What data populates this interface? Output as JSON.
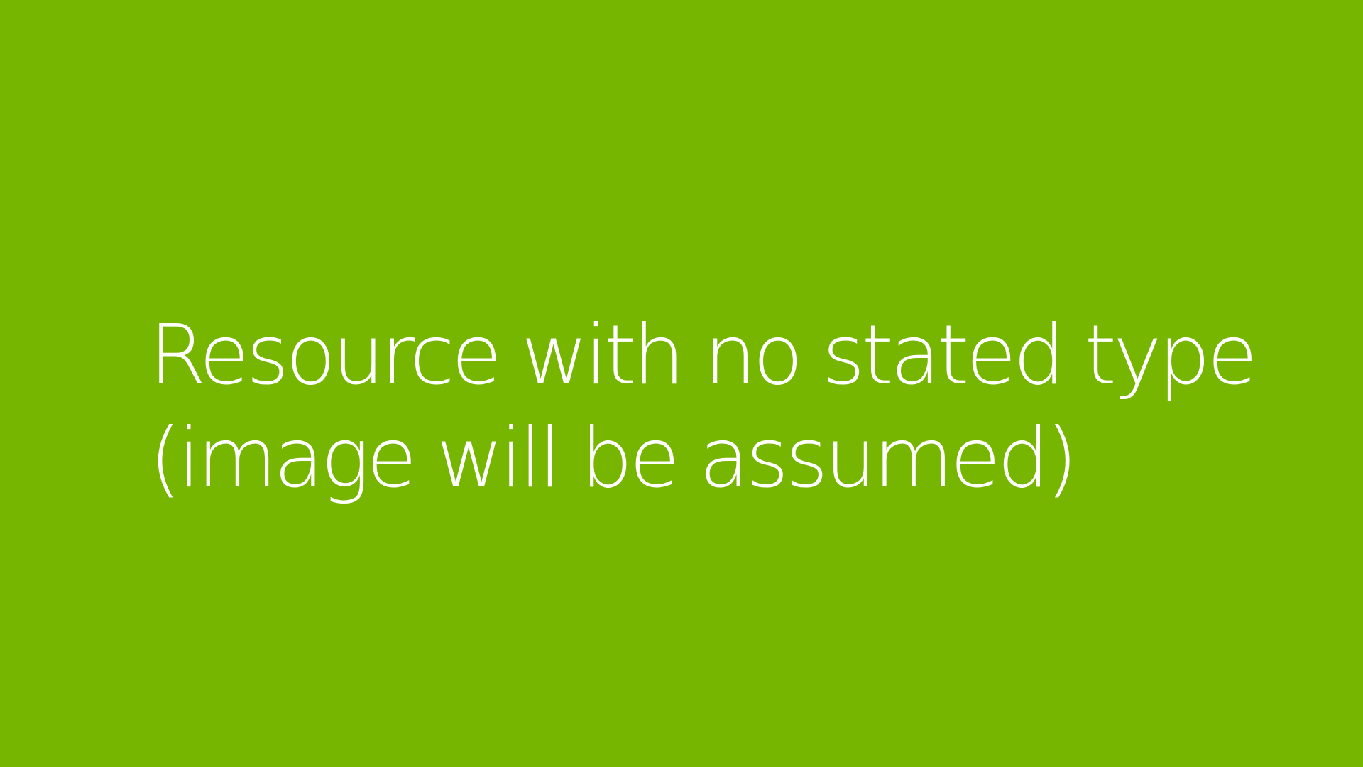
{
  "slide": {
    "background_color": "#76b600",
    "text_color": "#ffffff",
    "message": {
      "line1": "Resource with no stated type",
      "line2": "(image will be assumed)"
    }
  }
}
